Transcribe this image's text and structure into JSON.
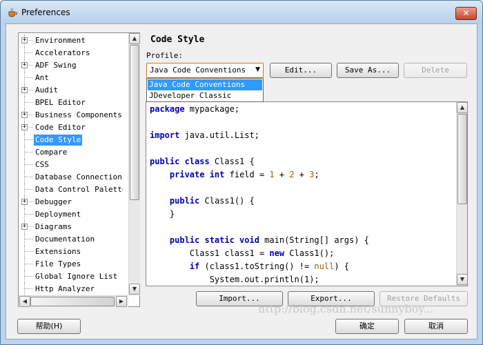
{
  "window": {
    "title": "Preferences",
    "close_label": "✕"
  },
  "tree": {
    "items": [
      {
        "label": "Environment",
        "expandable": true
      },
      {
        "label": "Accelerators",
        "expandable": false
      },
      {
        "label": "ADF Swing",
        "expandable": true
      },
      {
        "label": "Ant",
        "expandable": false
      },
      {
        "label": "Audit",
        "expandable": true
      },
      {
        "label": "BPEL Editor",
        "expandable": false
      },
      {
        "label": "Business Components",
        "expandable": true
      },
      {
        "label": "Code Editor",
        "expandable": true
      },
      {
        "label": "Code Style",
        "expandable": false,
        "selected": true
      },
      {
        "label": "Compare",
        "expandable": false
      },
      {
        "label": "CSS",
        "expandable": false
      },
      {
        "label": "Database Connections",
        "expandable": false
      },
      {
        "label": "Data Control Palette",
        "expandable": false
      },
      {
        "label": "Debugger",
        "expandable": true
      },
      {
        "label": "Deployment",
        "expandable": false
      },
      {
        "label": "Diagrams",
        "expandable": true
      },
      {
        "label": "Documentation",
        "expandable": false
      },
      {
        "label": "Extensions",
        "expandable": false
      },
      {
        "label": "File Types",
        "expandable": false
      },
      {
        "label": "Global Ignore List",
        "expandable": false
      },
      {
        "label": "Http Analyzer",
        "expandable": false
      }
    ]
  },
  "panel": {
    "title": "Code Style",
    "profile_label": "Profile:",
    "profile_value": "Java Code Conventions",
    "profile_options": [
      "Java Code Conventions",
      "JDeveloper Classic"
    ],
    "edit_label": "Edit...",
    "save_as_label": "Save As...",
    "delete_label": "Delete"
  },
  "code_preview": {
    "lines": [
      [
        {
          "t": "package",
          "c": "kw"
        },
        {
          "t": " mypackage;"
        }
      ],
      [],
      [
        {
          "t": "import",
          "c": "kw"
        },
        {
          "t": " java.util.List;"
        }
      ],
      [],
      [
        {
          "t": "public class",
          "c": "kw"
        },
        {
          "t": " Class1 {"
        }
      ],
      [
        {
          "t": "    "
        },
        {
          "t": "private int",
          "c": "kw"
        },
        {
          "t": " field = "
        },
        {
          "t": "1",
          "c": "num"
        },
        {
          "t": " + "
        },
        {
          "t": "2",
          "c": "num"
        },
        {
          "t": " + "
        },
        {
          "t": "3",
          "c": "num"
        },
        {
          "t": ";"
        }
      ],
      [],
      [
        {
          "t": "    "
        },
        {
          "t": "public",
          "c": "kw"
        },
        {
          "t": " Class1() {"
        }
      ],
      [
        {
          "t": "    }"
        }
      ],
      [],
      [
        {
          "t": "    "
        },
        {
          "t": "public static void",
          "c": "kw"
        },
        {
          "t": " main(String[] args) {"
        }
      ],
      [
        {
          "t": "        Class1 class1 = "
        },
        {
          "t": "new",
          "c": "kw"
        },
        {
          "t": " Class1();"
        }
      ],
      [
        {
          "t": "        "
        },
        {
          "t": "if",
          "c": "kw"
        },
        {
          "t": " (class1.toString() != "
        },
        {
          "t": "null",
          "c": "num"
        },
        {
          "t": ") {"
        }
      ],
      [
        {
          "t": "            System.out.println(1);"
        }
      ]
    ]
  },
  "actions": {
    "import_label": "Import...",
    "export_label": "Export...",
    "restore_label": "Restore Defaults"
  },
  "footer": {
    "help_label": "帮助(H)",
    "ok_label": "确定",
    "cancel_label": "取消"
  },
  "watermark": "http://blog.csdn.net/sunnyboy..."
}
